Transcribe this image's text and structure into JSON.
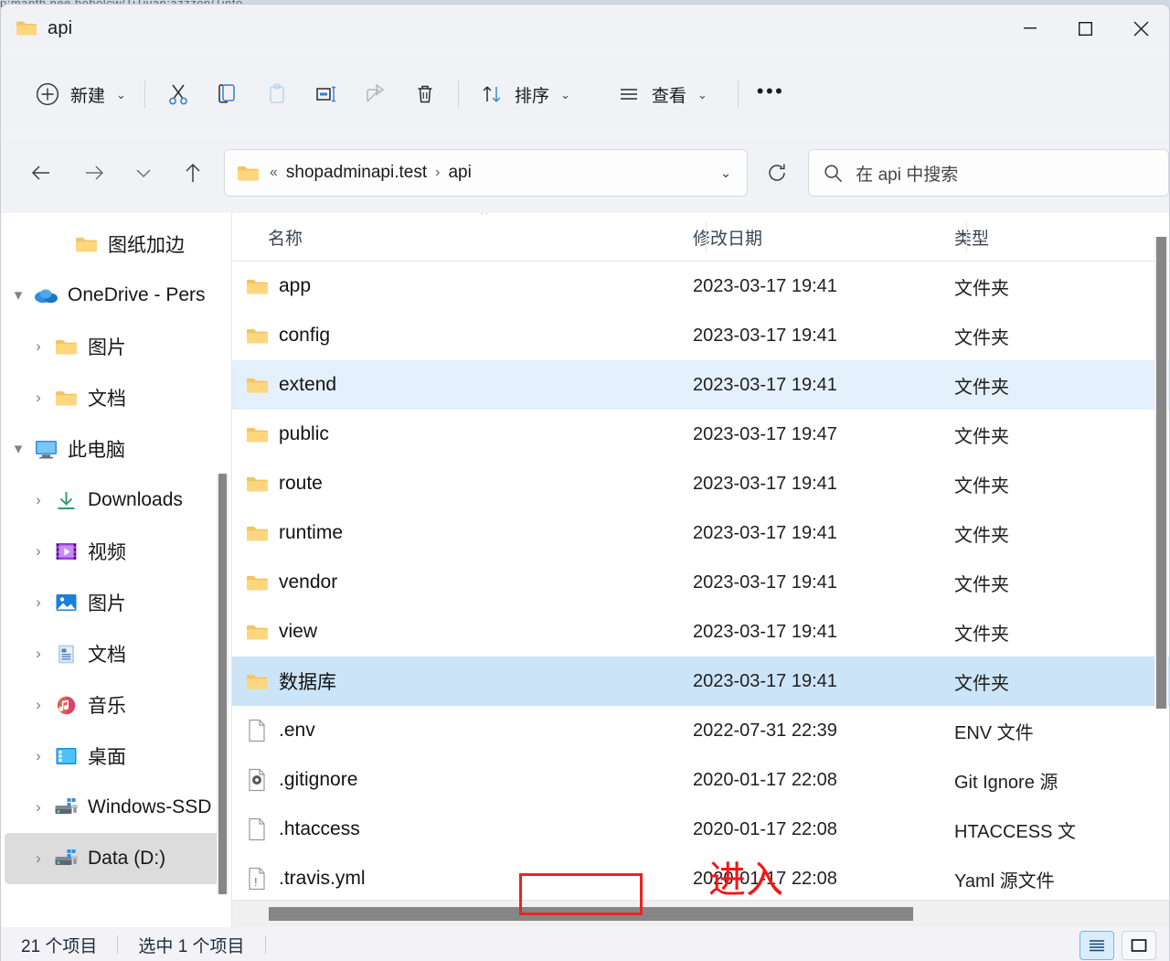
{
  "background": {
    "obscured_text": "p:manth.nee.bobolcw/TiTivan:azzzon/Tinto"
  },
  "window": {
    "title": "api",
    "title_icon": "folder-icon",
    "controls": {
      "minimize": "minimize-icon",
      "maximize": "maximize-icon",
      "close": "close-icon"
    }
  },
  "toolbar": {
    "new_label": "新建",
    "cut_label": "cut-icon",
    "copy_label": "copy-icon",
    "paste_label": "paste-icon",
    "rename_label": "rename-icon",
    "share_label": "share-icon",
    "delete_label": "delete-icon",
    "sort_label": "排序",
    "view_label": "查看",
    "more_label": "•••"
  },
  "address": {
    "back": "back-arrow-icon",
    "forward": "forward-arrow-icon",
    "recent": "chevron-down-icon",
    "up": "up-arrow-icon",
    "folder_icon": "folder-icon",
    "overflow": "«",
    "crumbs": [
      "shopadminapi.test",
      "api"
    ],
    "crumb_sep": "›",
    "dropdown": "chevron-down-icon",
    "refresh": "refresh-icon"
  },
  "search": {
    "icon": "search-icon",
    "placeholder": "在 api 中搜索",
    "value": ""
  },
  "sidebar": {
    "items": [
      {
        "label": "图纸加边",
        "icon": "folder-icon",
        "expander": "",
        "indent": 2,
        "selected": false
      },
      {
        "label": "OneDrive - Pers",
        "icon": "onedrive-icon",
        "expander": "▾",
        "indent": 0,
        "selected": false
      },
      {
        "label": "图片",
        "icon": "folder-icon",
        "expander": "›",
        "indent": 1,
        "selected": false
      },
      {
        "label": "文档",
        "icon": "folder-icon",
        "expander": "›",
        "indent": 1,
        "selected": false
      },
      {
        "label": "此电脑",
        "icon": "this-pc-icon",
        "expander": "▾",
        "indent": 0,
        "selected": false
      },
      {
        "label": "Downloads",
        "icon": "downloads-icon",
        "expander": "›",
        "indent": 1,
        "selected": false
      },
      {
        "label": "视频",
        "icon": "videos-icon",
        "expander": "›",
        "indent": 1,
        "selected": false
      },
      {
        "label": "图片",
        "icon": "pictures-icon",
        "expander": "›",
        "indent": 1,
        "selected": false
      },
      {
        "label": "文档",
        "icon": "documents-icon",
        "expander": "›",
        "indent": 1,
        "selected": false
      },
      {
        "label": "音乐",
        "icon": "music-icon",
        "expander": "›",
        "indent": 1,
        "selected": false
      },
      {
        "label": "桌面",
        "icon": "desktop-icon",
        "expander": "›",
        "indent": 1,
        "selected": false
      },
      {
        "label": "Windows-SSD",
        "icon": "drive-icon",
        "expander": "›",
        "indent": 1,
        "selected": false
      },
      {
        "label": "Data (D:)",
        "icon": "drive-icon",
        "expander": "›",
        "indent": 1,
        "selected": true
      }
    ]
  },
  "filelist": {
    "sort_indicator": "⌃",
    "columns": [
      {
        "key": "name",
        "label": "名称"
      },
      {
        "key": "date",
        "label": "修改日期"
      },
      {
        "key": "type",
        "label": "类型"
      }
    ],
    "rows": [
      {
        "name": "app",
        "date": "2023-03-17 19:41",
        "type": "文件夹",
        "icon": "folder-icon",
        "state": ""
      },
      {
        "name": "config",
        "date": "2023-03-17 19:41",
        "type": "文件夹",
        "icon": "folder-icon",
        "state": ""
      },
      {
        "name": "extend",
        "date": "2023-03-17 19:41",
        "type": "文件夹",
        "icon": "folder-icon",
        "state": "hl"
      },
      {
        "name": "public",
        "date": "2023-03-17 19:47",
        "type": "文件夹",
        "icon": "folder-icon",
        "state": ""
      },
      {
        "name": "route",
        "date": "2023-03-17 19:41",
        "type": "文件夹",
        "icon": "folder-icon",
        "state": ""
      },
      {
        "name": "runtime",
        "date": "2023-03-17 19:41",
        "type": "文件夹",
        "icon": "folder-icon",
        "state": ""
      },
      {
        "name": "vendor",
        "date": "2023-03-17 19:41",
        "type": "文件夹",
        "icon": "folder-icon",
        "state": ""
      },
      {
        "name": "view",
        "date": "2023-03-17 19:41",
        "type": "文件夹",
        "icon": "folder-icon",
        "state": ""
      },
      {
        "name": "数据库",
        "date": "2023-03-17 19:41",
        "type": "文件夹",
        "icon": "folder-icon",
        "state": "sel"
      },
      {
        "name": ".env",
        "date": "2022-07-31 22:39",
        "type": "ENV 文件",
        "icon": "file-icon",
        "state": ""
      },
      {
        "name": ".gitignore",
        "date": "2020-01-17 22:08",
        "type": "Git Ignore 源",
        "icon": "gear-file-icon",
        "state": ""
      },
      {
        "name": ".htaccess",
        "date": "2020-01-17 22:08",
        "type": "HTACCESS 文",
        "icon": "file-icon",
        "state": ""
      },
      {
        "name": ".travis.yml",
        "date": "2020-01-17 22:08",
        "type": "Yaml 源文件",
        "icon": "yaml-file-icon",
        "state": ""
      }
    ]
  },
  "annotations": {
    "highlight_box": "数据库",
    "callout_text": "进入",
    "color": "#ee2222"
  },
  "statusbar": {
    "item_count": "21 个项目",
    "selected_count": "选中 1 个项目",
    "view_details_icon": "details-view-icon",
    "view_tiles_icon": "large-icons-view-icon"
  },
  "colors": {
    "window_chrome": "#f1f2f6",
    "row_hover": "#e4f0fb",
    "row_selected": "#cce4f7",
    "accent_red": "#ee2222",
    "folder_yellow": "#fbc55b"
  }
}
